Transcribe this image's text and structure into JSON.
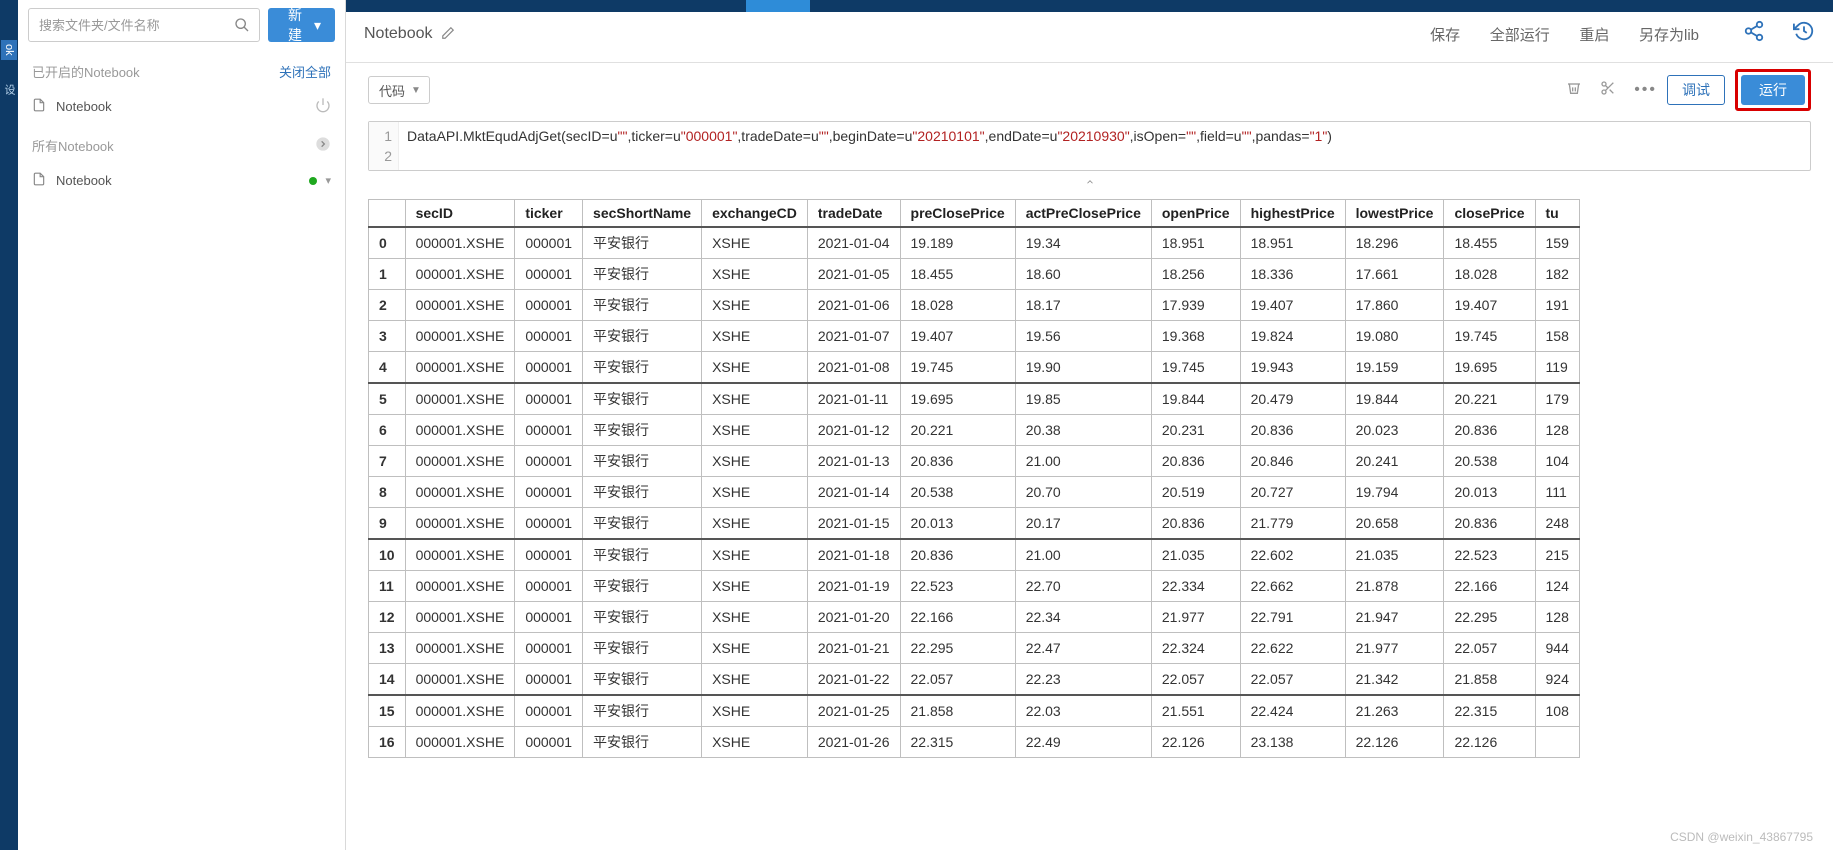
{
  "sidebar": {
    "search_placeholder": "搜索文件夹/文件名称",
    "new_button": "新建",
    "opened_section": "已开启的Notebook",
    "close_all": "关闭全部",
    "all_section": "所有Notebook",
    "opened_items": [
      {
        "name": "Notebook"
      }
    ],
    "all_items": [
      {
        "name": "Notebook"
      }
    ],
    "strip_label": "ok",
    "strip_label2": "设"
  },
  "header": {
    "title": "Notebook",
    "links": {
      "save": "保存",
      "run_all": "全部运行",
      "restart": "重启",
      "save_as": "另存为lib"
    }
  },
  "toolbar": {
    "cell_type": "代码",
    "debug": "调试",
    "run": "运行"
  },
  "code": {
    "line1_prefix": "DataAPI.MktEqudAdjGet(secID=u",
    "q": "\"\"",
    "ticker_key": ",ticker=u",
    "ticker_val": "\"000001\"",
    "trade_key": ",tradeDate=u",
    "begin_key": ",beginDate=u",
    "begin_val": "\"20210101\"",
    "end_key": ",endDate=u",
    "end_val": "\"20210930\"",
    "isopen_key": ",isOpen=",
    "field_key": ",field=u",
    "pandas_key": ",pandas=",
    "pandas_val": "\"1\"",
    "close": ")"
  },
  "table": {
    "columns": [
      "secID",
      "ticker",
      "secShortName",
      "exchangeCD",
      "tradeDate",
      "preClosePrice",
      "actPreClosePrice",
      "openPrice",
      "highestPrice",
      "lowestPrice",
      "closePrice",
      "tu"
    ],
    "rows": [
      {
        "idx": "0",
        "secID": "000001.XSHE",
        "ticker": "000001",
        "secShortName": "平安银行",
        "exchangeCD": "XSHE",
        "tradeDate": "2021-01-04",
        "preClosePrice": "19.189",
        "actPreClosePrice": "19.34",
        "openPrice": "18.951",
        "highestPrice": "18.951",
        "lowestPrice": "18.296",
        "closePrice": "18.455",
        "tu": "159"
      },
      {
        "idx": "1",
        "secID": "000001.XSHE",
        "ticker": "000001",
        "secShortName": "平安银行",
        "exchangeCD": "XSHE",
        "tradeDate": "2021-01-05",
        "preClosePrice": "18.455",
        "actPreClosePrice": "18.60",
        "openPrice": "18.256",
        "highestPrice": "18.336",
        "lowestPrice": "17.661",
        "closePrice": "18.028",
        "tu": "182"
      },
      {
        "idx": "2",
        "secID": "000001.XSHE",
        "ticker": "000001",
        "secShortName": "平安银行",
        "exchangeCD": "XSHE",
        "tradeDate": "2021-01-06",
        "preClosePrice": "18.028",
        "actPreClosePrice": "18.17",
        "openPrice": "17.939",
        "highestPrice": "19.407",
        "lowestPrice": "17.860",
        "closePrice": "19.407",
        "tu": "191"
      },
      {
        "idx": "3",
        "secID": "000001.XSHE",
        "ticker": "000001",
        "secShortName": "平安银行",
        "exchangeCD": "XSHE",
        "tradeDate": "2021-01-07",
        "preClosePrice": "19.407",
        "actPreClosePrice": "19.56",
        "openPrice": "19.368",
        "highestPrice": "19.824",
        "lowestPrice": "19.080",
        "closePrice": "19.745",
        "tu": "158"
      },
      {
        "idx": "4",
        "secID": "000001.XSHE",
        "ticker": "000001",
        "secShortName": "平安银行",
        "exchangeCD": "XSHE",
        "tradeDate": "2021-01-08",
        "preClosePrice": "19.745",
        "actPreClosePrice": "19.90",
        "openPrice": "19.745",
        "highestPrice": "19.943",
        "lowestPrice": "19.159",
        "closePrice": "19.695",
        "tu": "119"
      },
      {
        "idx": "5",
        "secID": "000001.XSHE",
        "ticker": "000001",
        "secShortName": "平安银行",
        "exchangeCD": "XSHE",
        "tradeDate": "2021-01-11",
        "preClosePrice": "19.695",
        "actPreClosePrice": "19.85",
        "openPrice": "19.844",
        "highestPrice": "20.479",
        "lowestPrice": "19.844",
        "closePrice": "20.221",
        "tu": "179"
      },
      {
        "idx": "6",
        "secID": "000001.XSHE",
        "ticker": "000001",
        "secShortName": "平安银行",
        "exchangeCD": "XSHE",
        "tradeDate": "2021-01-12",
        "preClosePrice": "20.221",
        "actPreClosePrice": "20.38",
        "openPrice": "20.231",
        "highestPrice": "20.836",
        "lowestPrice": "20.023",
        "closePrice": "20.836",
        "tu": "128"
      },
      {
        "idx": "7",
        "secID": "000001.XSHE",
        "ticker": "000001",
        "secShortName": "平安银行",
        "exchangeCD": "XSHE",
        "tradeDate": "2021-01-13",
        "preClosePrice": "20.836",
        "actPreClosePrice": "21.00",
        "openPrice": "20.836",
        "highestPrice": "20.846",
        "lowestPrice": "20.241",
        "closePrice": "20.538",
        "tu": "104"
      },
      {
        "idx": "8",
        "secID": "000001.XSHE",
        "ticker": "000001",
        "secShortName": "平安银行",
        "exchangeCD": "XSHE",
        "tradeDate": "2021-01-14",
        "preClosePrice": "20.538",
        "actPreClosePrice": "20.70",
        "openPrice": "20.519",
        "highestPrice": "20.727",
        "lowestPrice": "19.794",
        "closePrice": "20.013",
        "tu": "111"
      },
      {
        "idx": "9",
        "secID": "000001.XSHE",
        "ticker": "000001",
        "secShortName": "平安银行",
        "exchangeCD": "XSHE",
        "tradeDate": "2021-01-15",
        "preClosePrice": "20.013",
        "actPreClosePrice": "20.17",
        "openPrice": "20.836",
        "highestPrice": "21.779",
        "lowestPrice": "20.658",
        "closePrice": "20.836",
        "tu": "248"
      },
      {
        "idx": "10",
        "secID": "000001.XSHE",
        "ticker": "000001",
        "secShortName": "平安银行",
        "exchangeCD": "XSHE",
        "tradeDate": "2021-01-18",
        "preClosePrice": "20.836",
        "actPreClosePrice": "21.00",
        "openPrice": "21.035",
        "highestPrice": "22.602",
        "lowestPrice": "21.035",
        "closePrice": "22.523",
        "tu": "215"
      },
      {
        "idx": "11",
        "secID": "000001.XSHE",
        "ticker": "000001",
        "secShortName": "平安银行",
        "exchangeCD": "XSHE",
        "tradeDate": "2021-01-19",
        "preClosePrice": "22.523",
        "actPreClosePrice": "22.70",
        "openPrice": "22.334",
        "highestPrice": "22.662",
        "lowestPrice": "21.878",
        "closePrice": "22.166",
        "tu": "124"
      },
      {
        "idx": "12",
        "secID": "000001.XSHE",
        "ticker": "000001",
        "secShortName": "平安银行",
        "exchangeCD": "XSHE",
        "tradeDate": "2021-01-20",
        "preClosePrice": "22.166",
        "actPreClosePrice": "22.34",
        "openPrice": "21.977",
        "highestPrice": "22.791",
        "lowestPrice": "21.947",
        "closePrice": "22.295",
        "tu": "128"
      },
      {
        "idx": "13",
        "secID": "000001.XSHE",
        "ticker": "000001",
        "secShortName": "平安银行",
        "exchangeCD": "XSHE",
        "tradeDate": "2021-01-21",
        "preClosePrice": "22.295",
        "actPreClosePrice": "22.47",
        "openPrice": "22.324",
        "highestPrice": "22.622",
        "lowestPrice": "21.977",
        "closePrice": "22.057",
        "tu": "944"
      },
      {
        "idx": "14",
        "secID": "000001.XSHE",
        "ticker": "000001",
        "secShortName": "平安银行",
        "exchangeCD": "XSHE",
        "tradeDate": "2021-01-22",
        "preClosePrice": "22.057",
        "actPreClosePrice": "22.23",
        "openPrice": "22.057",
        "highestPrice": "22.057",
        "lowestPrice": "21.342",
        "closePrice": "21.858",
        "tu": "924"
      },
      {
        "idx": "15",
        "secID": "000001.XSHE",
        "ticker": "000001",
        "secShortName": "平安银行",
        "exchangeCD": "XSHE",
        "tradeDate": "2021-01-25",
        "preClosePrice": "21.858",
        "actPreClosePrice": "22.03",
        "openPrice": "21.551",
        "highestPrice": "22.424",
        "lowestPrice": "21.263",
        "closePrice": "22.315",
        "tu": "108"
      },
      {
        "idx": "16",
        "secID": "000001.XSHE",
        "ticker": "000001",
        "secShortName": "平安银行",
        "exchangeCD": "XSHE",
        "tradeDate": "2021-01-26",
        "preClosePrice": "22.315",
        "actPreClosePrice": "22.49",
        "openPrice": "22.126",
        "highestPrice": "23.138",
        "lowestPrice": "22.126",
        "closePrice": "22.126",
        "tu": ""
      }
    ]
  },
  "watermark": "CSDN @weixin_43867795"
}
